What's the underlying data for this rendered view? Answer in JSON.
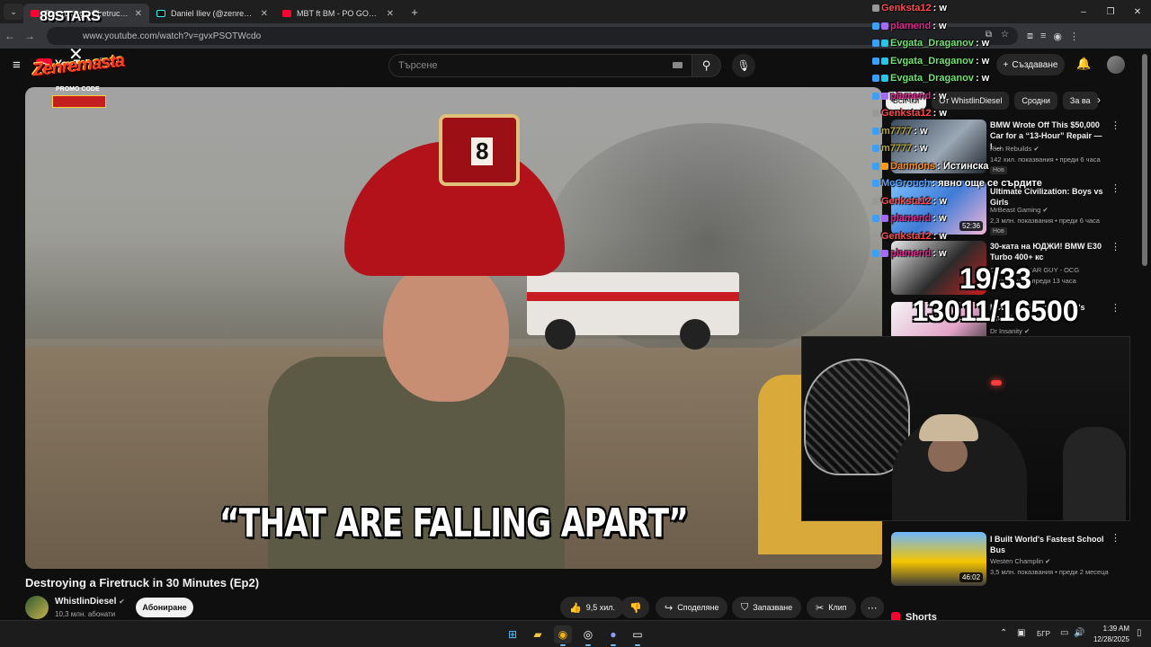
{
  "browser": {
    "tabs": [
      {
        "title": "Destroying a Firetruck in 30 Minutes",
        "icon": "youtube-icon",
        "active": true
      },
      {
        "title": "Daniel Iliev (@zenremasta) | TikTok",
        "icon": "tiktok-icon",
        "active": false
      },
      {
        "title": "MBT ft BM - PO GORESHTOTO",
        "icon": "youtube-icon",
        "active": false
      }
    ],
    "new_tab": "+",
    "url": "www.youtube.com/watch?v=gvxPSOTWcdo",
    "window_controls": [
      "–",
      "❐",
      "✕"
    ]
  },
  "youtube": {
    "logo_text": "YouTube",
    "country_code": "BG",
    "search_placeholder": "Търсене",
    "create_label": "Създаване",
    "video": {
      "caption": "“THAT ARE FALLING APART”",
      "title": "Destroying a Firetruck in 30 Minutes (Ep2)",
      "helmet_number": "8"
    },
    "channel": {
      "name": "WhistlinDiesel",
      "subscribers": "10,3 млн. абонати",
      "subscribe_label": "Абониране"
    },
    "actions": {
      "likes": "9,5 хил.",
      "share": "Споделяне",
      "save": "Запазване",
      "clip": "Клип"
    },
    "chips": [
      "Всички",
      "От WhistlinDiesel",
      "Сродни",
      "За ва"
    ],
    "recommendations": [
      {
        "title": "BMW Wrote Off This $50,000 Car for a “13-Hour” Repair — I ...",
        "channel": "Rich Rebuilds",
        "meta": "142 хил. показвания • преди 6 часа",
        "badge": "Нов",
        "duration": ""
      },
      {
        "title": "Ultimate Civilization: Boys vs Girls",
        "channel": "MrBeast Gaming",
        "meta": "2,3 млн. показвания • преди 6 часа",
        "badge": "Нов",
        "duration": "52:36"
      },
      {
        "title": "30-ката на ЮДЖИ! BMW E30 Turbo 400+ кс",
        "channel": "ORDINARY CAR GUY - OCG",
        "meta": "показвания • преди 13 часа",
        "badge": "",
        "duration": ""
      },
      {
        "title": "How I Destroyed World's Smartest Robot",
        "channel": "Dr Insanity",
        "meta": "",
        "badge": "",
        "duration": ""
      },
      {
        "title": "I Built World's Fastest School Bus",
        "channel": "Westen Champlin",
        "meta": "3,5 млн. показвания • преди 2 месеца",
        "badge": "",
        "duration": "46:02"
      }
    ],
    "shorts_label": "Shorts"
  },
  "overlay": {
    "brand_top": "89STARS",
    "brand_x": "✕",
    "brand_name": "Zenremasta",
    "promo": "PROMO CODE",
    "counter_line1": "19/33",
    "counter_line2": "13011/16500",
    "chat": [
      {
        "user": "Genksta12",
        "msg": ": w",
        "color": "#ff4d4d"
      },
      {
        "user": "plamend",
        "msg": ": w",
        "color": "#e0248f"
      },
      {
        "user": "Evgata_Draganov",
        "msg": ": w",
        "color": "#6fe36f"
      },
      {
        "user": "Evgata_Draganov",
        "msg": ": w",
        "color": "#6fe36f"
      },
      {
        "user": "Evgata_Draganov",
        "msg": ": w",
        "color": "#6fe36f"
      },
      {
        "user": "plamend",
        "msg": ": w",
        "color": "#e0248f"
      },
      {
        "user": "Genksta12",
        "msg": ": w",
        "color": "#ff4d4d"
      },
      {
        "user": "m7777",
        "msg": ": w",
        "color": "#b6a640"
      },
      {
        "user": "m7777",
        "msg": ": w",
        "color": "#b6a640"
      },
      {
        "user": "Danmons",
        "msg": ": Истинска",
        "color": "#ff8c1a"
      },
      {
        "user": "McGrouch",
        "msg": ": явно още се сърдите",
        "color": "#5aa0ff"
      },
      {
        "user": "Genksta12",
        "msg": ": w",
        "color": "#ff4d4d"
      },
      {
        "user": "plamend",
        "msg": ": w",
        "color": "#e0248f"
      },
      {
        "user": "Genksta12",
        "msg": ": w",
        "color": "#ff4d4d"
      },
      {
        "user": "plamend",
        "msg": ": w",
        "color": "#e0248f"
      }
    ]
  },
  "taskbar": {
    "language": "БГР",
    "time": "1:39 AM",
    "date": "12/28/2025"
  }
}
